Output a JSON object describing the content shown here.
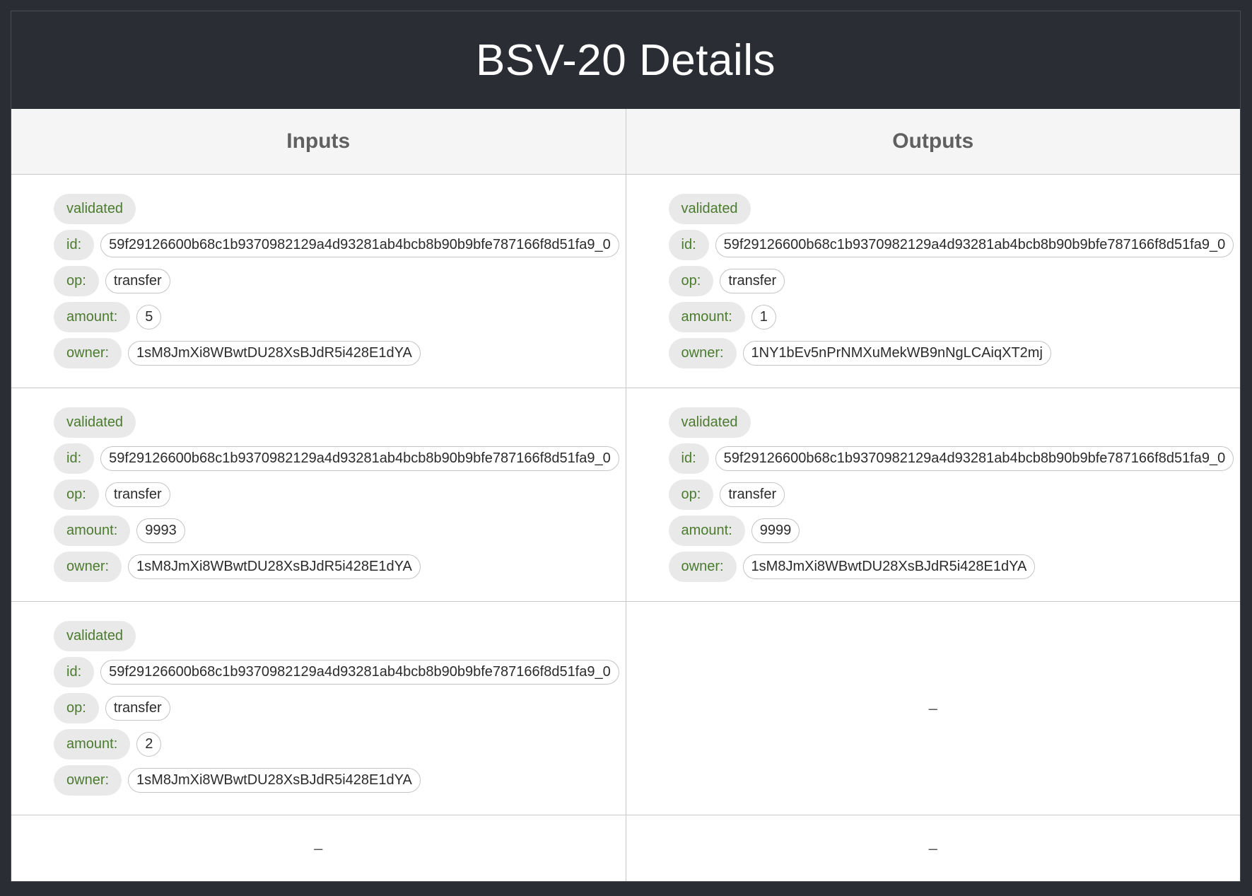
{
  "page": {
    "title": "BSV-20 Details"
  },
  "table": {
    "headers": {
      "inputs": "Inputs",
      "outputs": "Outputs"
    },
    "labels": {
      "validated": "validated",
      "id": "id:",
      "op": "op:",
      "amount": "amount:",
      "owner": "owner:"
    },
    "empty": "–",
    "rows": [
      {
        "input": {
          "id": "59f29126600b68c1b9370982129a4d93281ab4bcb8b90b9bfe787166f8d51fa9_0",
          "op": "transfer",
          "amount": "5",
          "owner": "1sM8JmXi8WBwtDU28XsBJdR5i428E1dYA"
        },
        "output": {
          "id": "59f29126600b68c1b9370982129a4d93281ab4bcb8b90b9bfe787166f8d51fa9_0",
          "op": "transfer",
          "amount": "1",
          "owner": "1NY1bEv5nPrNMXuMekWB9nNgLCAiqXT2mj"
        }
      },
      {
        "input": {
          "id": "59f29126600b68c1b9370982129a4d93281ab4bcb8b90b9bfe787166f8d51fa9_0",
          "op": "transfer",
          "amount": "9993",
          "owner": "1sM8JmXi8WBwtDU28XsBJdR5i428E1dYA"
        },
        "output": {
          "id": "59f29126600b68c1b9370982129a4d93281ab4bcb8b90b9bfe787166f8d51fa9_0",
          "op": "transfer",
          "amount": "9999",
          "owner": "1sM8JmXi8WBwtDU28XsBJdR5i428E1dYA"
        }
      },
      {
        "input": {
          "id": "59f29126600b68c1b9370982129a4d93281ab4bcb8b90b9bfe787166f8d51fa9_0",
          "op": "transfer",
          "amount": "2",
          "owner": "1sM8JmXi8WBwtDU28XsBJdR5i428E1dYA"
        },
        "output": null
      },
      {
        "input": null,
        "output": null
      }
    ]
  }
}
